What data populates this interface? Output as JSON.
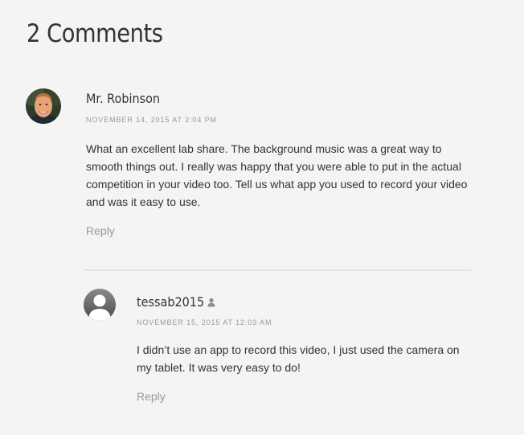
{
  "comments_title": "2 Comments",
  "comments": [
    {
      "author": "Mr. Robinson",
      "date": "NOVEMBER 14, 2015 AT 2:04 PM",
      "text": "What an excellent lab share. The background music was a great way to smooth things out. I really was happy that you were able to put in the actual competition in your video too. Tell us what app you used to record your video and was it easy to use.",
      "reply_label": "Reply",
      "avatar": "avatar-photo"
    },
    {
      "author": "tessab2015",
      "author_icon": "user-icon",
      "date": "NOVEMBER 15, 2015 AT 12:03 AM",
      "text": "I didn’t use an app to record this video, I just used the camera on my tablet. It was very easy to do!",
      "reply_label": "Reply",
      "avatar": "default-user-avatar"
    }
  ],
  "colors": {
    "background": "#f4f4f4",
    "text": "#333333",
    "meta": "#999999",
    "divider": "#e4e4e4"
  }
}
